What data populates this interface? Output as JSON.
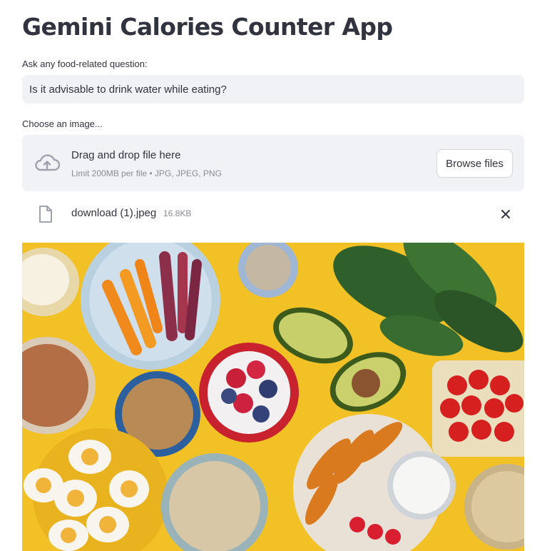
{
  "app": {
    "title": "Gemini Calories Counter App"
  },
  "question": {
    "label": "Ask any food-related question:",
    "value": "Is it advisable to drink water while eating?"
  },
  "uploader": {
    "label": "Choose an image...",
    "drag_text": "Drag and drop file here",
    "limit_text": "Limit 200MB per file • JPG, JPEG, PNG",
    "browse_label": "Browse files",
    "upload_icon": "cloud-upload-icon"
  },
  "uploaded_file": {
    "name": "download (1).jpeg",
    "size": "16.8KB",
    "file_icon": "file-icon",
    "remove_icon": "close-icon"
  },
  "image": {
    "subject": "food-spread-photo"
  }
}
